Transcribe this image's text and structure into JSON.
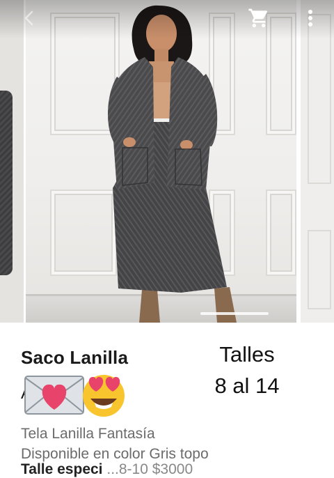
{
  "header": {
    "back_icon": "back-arrow-icon",
    "cart_icon": "cart-icon",
    "menu_icon": "more-vertical-icon"
  },
  "carousel": {
    "image_description_icon": "product-photo",
    "indicator_icon": "page-indicator"
  },
  "product": {
    "title": "Saco Lanilla",
    "title_line2_start": "A",
    "emojis": [
      "envelope-with-heart-icon",
      "heart-eyes-icon"
    ],
    "sizes_line1": "Talles",
    "sizes_line2": "8 al 14",
    "description_line1": "Tela Lanilla Fantasía",
    "description_line2": "Disponible en color Gris topo",
    "price_partial_label": "Talle especi",
    "price_partial_value": "...8-10 $3000"
  },
  "colors": {
    "fabric": "#4a4a4c",
    "skin": "#c98f6b",
    "wall": "#f1f0ee",
    "heart": "#e8436a",
    "emoji_face": "#f8c52e"
  }
}
